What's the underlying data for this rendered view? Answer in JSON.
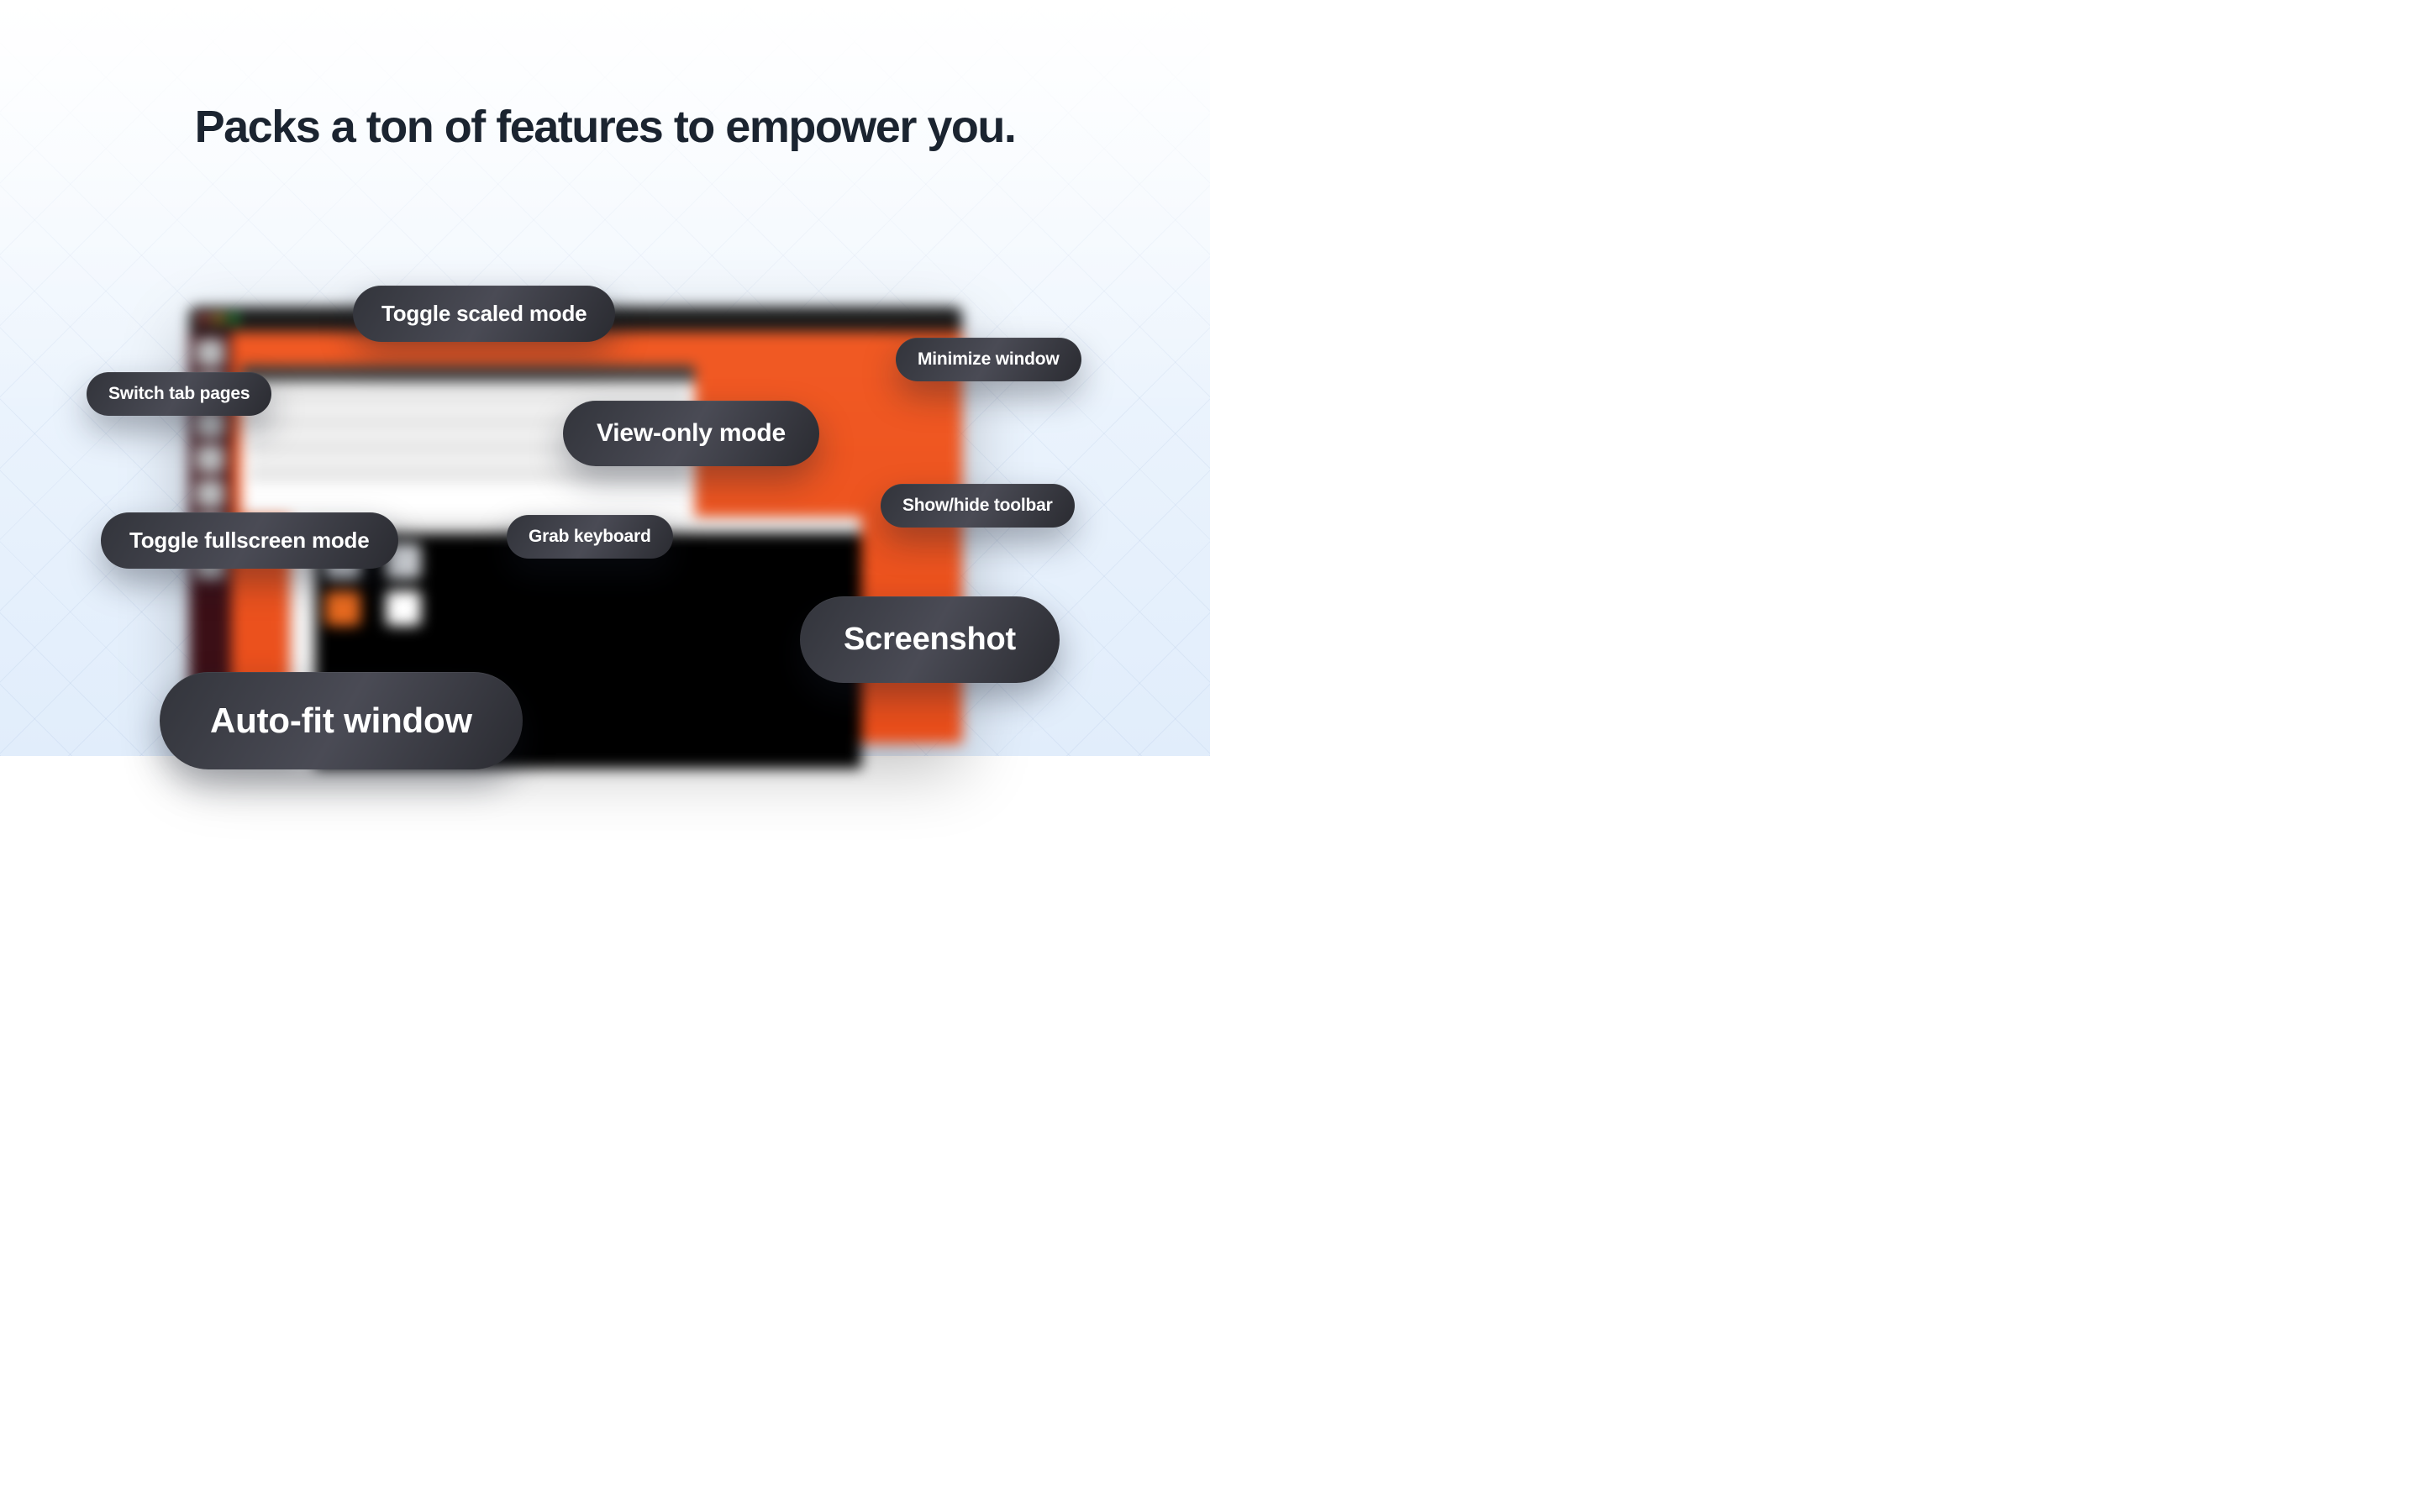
{
  "headline": "Packs a ton of features to empower you.",
  "pills": {
    "toggle_scaled": "Toggle scaled mode",
    "switch_tab": "Switch tab pages",
    "view_only": "View-only mode",
    "minimize": "Minimize window",
    "toggle_fullscreen": "Toggle fullscreen mode",
    "grab_keyboard": "Grab keyboard",
    "show_hide_toolbar": "Show/hide toolbar",
    "screenshot": "Screenshot",
    "autofit": "Auto-fit window"
  }
}
